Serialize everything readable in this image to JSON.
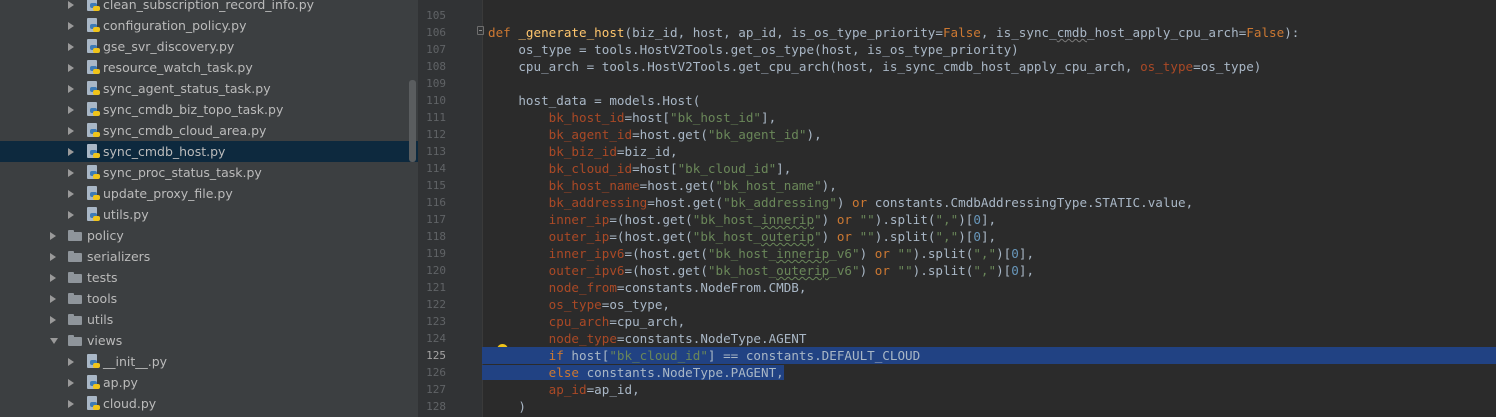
{
  "project_tree": {
    "items": [
      {
        "label": "clean_subscription_record_info.py",
        "type": "file",
        "indent": 2
      },
      {
        "label": "configuration_policy.py",
        "type": "file",
        "indent": 2
      },
      {
        "label": "gse_svr_discovery.py",
        "type": "file",
        "indent": 2
      },
      {
        "label": "resource_watch_task.py",
        "type": "file",
        "indent": 2
      },
      {
        "label": "sync_agent_status_task.py",
        "type": "file",
        "indent": 2
      },
      {
        "label": "sync_cmdb_biz_topo_task.py",
        "type": "file",
        "indent": 2
      },
      {
        "label": "sync_cmdb_cloud_area.py",
        "type": "file",
        "indent": 2
      },
      {
        "label": "sync_cmdb_host.py",
        "type": "file",
        "indent": 2,
        "selected": true
      },
      {
        "label": "sync_proc_status_task.py",
        "type": "file",
        "indent": 2
      },
      {
        "label": "update_proxy_file.py",
        "type": "file",
        "indent": 2
      },
      {
        "label": "utils.py",
        "type": "file",
        "indent": 2
      },
      {
        "label": "policy",
        "type": "folder",
        "indent": 1
      },
      {
        "label": "serializers",
        "type": "folder",
        "indent": 1
      },
      {
        "label": "tests",
        "type": "folder",
        "indent": 1
      },
      {
        "label": "tools",
        "type": "folder",
        "indent": 1
      },
      {
        "label": "utils",
        "type": "folder",
        "indent": 1
      },
      {
        "label": "views",
        "type": "folder",
        "indent": 1,
        "expanded": true
      },
      {
        "label": "__init__.py",
        "type": "file",
        "indent": 2
      },
      {
        "label": "ap.py",
        "type": "file",
        "indent": 2
      },
      {
        "label": "cloud.py",
        "type": "file",
        "indent": 2
      }
    ]
  },
  "editor": {
    "current_line": "125",
    "lines": [
      {
        "n": "105"
      },
      {
        "n": "106"
      },
      {
        "n": "107"
      },
      {
        "n": "108"
      },
      {
        "n": "109"
      },
      {
        "n": "110"
      },
      {
        "n": "111"
      },
      {
        "n": "112"
      },
      {
        "n": "113"
      },
      {
        "n": "114"
      },
      {
        "n": "115"
      },
      {
        "n": "116"
      },
      {
        "n": "117"
      },
      {
        "n": "118"
      },
      {
        "n": "119"
      },
      {
        "n": "120"
      },
      {
        "n": "121"
      },
      {
        "n": "122"
      },
      {
        "n": "123"
      },
      {
        "n": "124"
      },
      {
        "n": "125"
      },
      {
        "n": "126"
      },
      {
        "n": "127"
      },
      {
        "n": "128"
      }
    ],
    "code": {
      "l106": [
        [
          "kw",
          "def "
        ],
        [
          "fn",
          "_generate_host"
        ],
        [
          "",
          "(biz_id, host, ap_id, is_os_type_priority="
        ],
        [
          "kw",
          "False"
        ],
        [
          "",
          ", is_sync_"
        ],
        [
          "sq",
          "cmdb"
        ],
        [
          "",
          "_host_apply_cpu_arch="
        ],
        [
          "kw",
          "False"
        ],
        [
          "",
          "):"
        ]
      ],
      "l107": [
        [
          "",
          "    os_type = tools.HostV2Tools.get_os_type(host, is_os_type_priority)"
        ]
      ],
      "l108": [
        [
          "",
          "    cpu_arch = tools.HostV2Tools.get_cpu_arch(host, is_sync_cmdb_host_apply_cpu_arch, "
        ],
        [
          "prm",
          "os_type"
        ],
        [
          "",
          "=os_type)"
        ]
      ],
      "l110": [
        [
          "",
          "    host_data = models.Host("
        ]
      ],
      "l111": [
        [
          "",
          "        "
        ],
        [
          "prm",
          "bk_host_id"
        ],
        [
          "",
          "=host["
        ],
        [
          "str",
          "\"bk_host_id\""
        ],
        [
          "",
          "],"
        ]
      ],
      "l112": [
        [
          "",
          "        "
        ],
        [
          "prm",
          "bk_agent_id"
        ],
        [
          "",
          "=host.get("
        ],
        [
          "str",
          "\"bk_agent_id\""
        ],
        [
          "",
          "),"
        ]
      ],
      "l113": [
        [
          "",
          "        "
        ],
        [
          "prm",
          "bk_biz_id"
        ],
        [
          "",
          "=biz_id,"
        ]
      ],
      "l114": [
        [
          "",
          "        "
        ],
        [
          "prm",
          "bk_cloud_id"
        ],
        [
          "",
          "=host["
        ],
        [
          "str",
          "\"bk_cloud_id\""
        ],
        [
          "",
          "],"
        ]
      ],
      "l115": [
        [
          "",
          "        "
        ],
        [
          "prm",
          "bk_host_name"
        ],
        [
          "",
          "=host.get("
        ],
        [
          "str",
          "\"bk_host_name\""
        ],
        [
          "",
          "),"
        ]
      ],
      "l116": [
        [
          "",
          "        "
        ],
        [
          "prm",
          "bk_addressing"
        ],
        [
          "",
          "=host.get("
        ],
        [
          "str",
          "\"bk_addressing\""
        ],
        [
          "",
          ") "
        ],
        [
          "kw",
          "or"
        ],
        [
          "",
          " constants.CmdbAddressingType.STATIC.value,"
        ]
      ],
      "l117": [
        [
          "",
          "        "
        ],
        [
          "prm",
          "inner_ip"
        ],
        [
          "",
          "=(host.get("
        ],
        [
          "str",
          "\"bk_host_"
        ],
        [
          "strsq",
          "innerip"
        ],
        [
          "str",
          "\""
        ],
        [
          "",
          ") "
        ],
        [
          "kw",
          "or"
        ],
        [
          "str",
          " \"\""
        ],
        [
          "",
          ").split("
        ],
        [
          "str",
          "\",\""
        ],
        [
          "",
          ")["
        ],
        [
          "num",
          "0"
        ],
        [
          "",
          "],"
        ]
      ],
      "l118": [
        [
          "",
          "        "
        ],
        [
          "prm",
          "outer_ip"
        ],
        [
          "",
          "=(host.get("
        ],
        [
          "str",
          "\"bk_host_"
        ],
        [
          "strsq",
          "outerip"
        ],
        [
          "str",
          "\""
        ],
        [
          "",
          ") "
        ],
        [
          "kw",
          "or"
        ],
        [
          "str",
          " \"\""
        ],
        [
          "",
          ").split("
        ],
        [
          "str",
          "\",\""
        ],
        [
          "",
          ")["
        ],
        [
          "num",
          "0"
        ],
        [
          "",
          "],"
        ]
      ],
      "l119": [
        [
          "",
          "        "
        ],
        [
          "prm",
          "inner_ipv6"
        ],
        [
          "",
          "=(host.get("
        ],
        [
          "str",
          "\"bk_host_"
        ],
        [
          "strsq",
          "innerip"
        ],
        [
          "str",
          "_v6\""
        ],
        [
          "",
          ") "
        ],
        [
          "kw",
          "or"
        ],
        [
          "str",
          " \"\""
        ],
        [
          "",
          ").split("
        ],
        [
          "str",
          "\",\""
        ],
        [
          "",
          ")["
        ],
        [
          "num",
          "0"
        ],
        [
          "",
          "],"
        ]
      ],
      "l120": [
        [
          "",
          "        "
        ],
        [
          "prm",
          "outer_ipv6"
        ],
        [
          "",
          "=(host.get("
        ],
        [
          "str",
          "\"bk_host_"
        ],
        [
          "strsq",
          "outerip"
        ],
        [
          "str",
          "_v6\""
        ],
        [
          "",
          ") "
        ],
        [
          "kw",
          "or"
        ],
        [
          "str",
          " \"\""
        ],
        [
          "",
          ").split("
        ],
        [
          "str",
          "\",\""
        ],
        [
          "",
          ")["
        ],
        [
          "num",
          "0"
        ],
        [
          "",
          "],"
        ]
      ],
      "l121": [
        [
          "",
          "        "
        ],
        [
          "prm",
          "node_from"
        ],
        [
          "",
          "=constants.NodeFrom.CMDB,"
        ]
      ],
      "l122": [
        [
          "",
          "        "
        ],
        [
          "prm",
          "os_type"
        ],
        [
          "",
          "=os_type,"
        ]
      ],
      "l123": [
        [
          "",
          "        "
        ],
        [
          "prm",
          "cpu_arch"
        ],
        [
          "",
          "=cpu_arch,"
        ]
      ],
      "l124": [
        [
          "",
          "        "
        ],
        [
          "prm",
          "node_type"
        ],
        [
          "",
          "=constants.NodeType.AGENT"
        ]
      ],
      "l125": [
        [
          "",
          "        "
        ],
        [
          "kw",
          "if"
        ],
        [
          "",
          " host["
        ],
        [
          "str",
          "\"bk_cloud_id\""
        ],
        [
          "",
          "] == constants.DEFAULT_CLOUD"
        ]
      ],
      "l126": [
        [
          "",
          "        "
        ],
        [
          "kw",
          "else"
        ],
        [
          "",
          " constants.NodeType.PAGENT,"
        ]
      ],
      "l127": [
        [
          "",
          "        "
        ],
        [
          "prm",
          "ap_id"
        ],
        [
          "",
          "=ap_id,"
        ]
      ],
      "l128": [
        [
          "",
          "    )"
        ]
      ]
    }
  },
  "colors": {
    "tree_bg": "#3c3f41",
    "editor_bg": "#2b2b2b",
    "gutter_bg": "#313335",
    "selection": "#214283",
    "keyword": "#cc7832",
    "string": "#6a8759",
    "param": "#aa4926",
    "function": "#ffc66d",
    "number": "#6897bb"
  },
  "icons": {
    "file": "python-file-icon",
    "folder": "folder-icon",
    "gutter_hint": "lightbulb-icon"
  }
}
